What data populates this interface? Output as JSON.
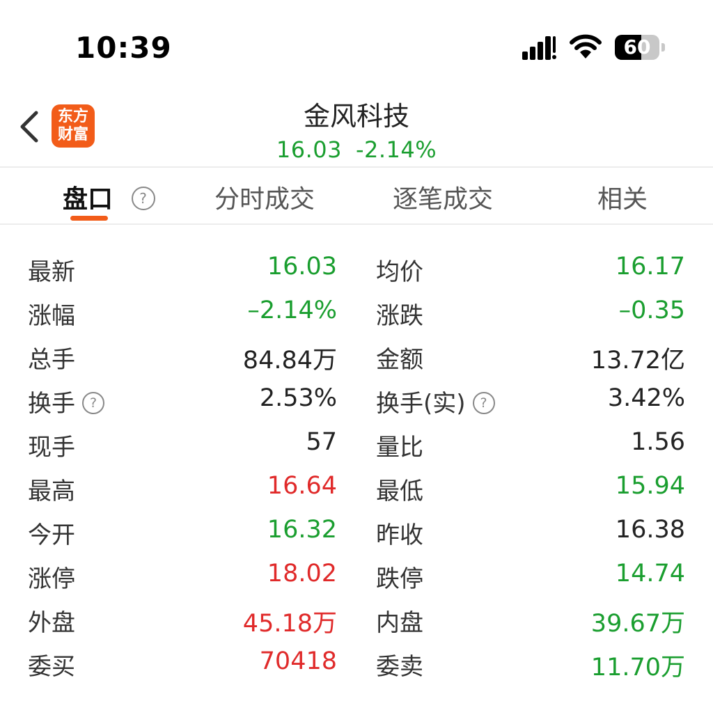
{
  "status": {
    "time": "10:39",
    "battery": "60",
    "battery_level": 0.6
  },
  "header": {
    "logo_line1": "东方",
    "logo_line2": "财富",
    "stock_name": "金风科技",
    "price": "16.03",
    "change_pct": "-2.14%"
  },
  "tabs": [
    "盘口",
    "分时成交",
    "逐笔成交",
    "相关"
  ],
  "tab_help": "?",
  "rows": [
    {
      "l_label": "最新",
      "l_value": "16.03",
      "l_color": "green",
      "r_label": "均价",
      "r_value": "16.17",
      "r_color": "green"
    },
    {
      "l_label": "涨幅",
      "l_value": "–2.14%",
      "l_color": "green",
      "r_label": "涨跌",
      "r_value": "–0.35",
      "r_color": "green"
    },
    {
      "l_label": "总手",
      "l_value": "84.84万",
      "l_color": "black",
      "r_label": "金额",
      "r_value": "13.72亿",
      "r_color": "black"
    },
    {
      "l_label": "换手",
      "l_help": true,
      "l_value": "2.53%",
      "l_color": "black",
      "r_label": "换手(实)",
      "r_help": true,
      "r_value": "3.42%",
      "r_color": "black"
    },
    {
      "l_label": "现手",
      "l_value": "57",
      "l_color": "black",
      "r_label": "量比",
      "r_value": "1.56",
      "r_color": "black"
    },
    {
      "l_label": "最高",
      "l_value": "16.64",
      "l_color": "red",
      "r_label": "最低",
      "r_value": "15.94",
      "r_color": "green"
    },
    {
      "l_label": "今开",
      "l_value": "16.32",
      "l_color": "green",
      "r_label": "昨收",
      "r_value": "16.38",
      "r_color": "black"
    },
    {
      "l_label": "涨停",
      "l_value": "18.02",
      "l_color": "red",
      "r_label": "跌停",
      "r_value": "14.74",
      "r_color": "green"
    },
    {
      "l_label": "外盘",
      "l_value": "45.18万",
      "l_color": "red",
      "r_label": "内盘",
      "r_value": "39.67万",
      "r_color": "green"
    },
    {
      "l_label": "委买",
      "l_value": "70418",
      "l_color": "red",
      "r_label": "委卖",
      "r_value": "11.70万",
      "r_color": "green"
    }
  ],
  "colors": {
    "accent": "#f25c19",
    "green": "#1a9e2f",
    "red": "#e02a2a"
  }
}
